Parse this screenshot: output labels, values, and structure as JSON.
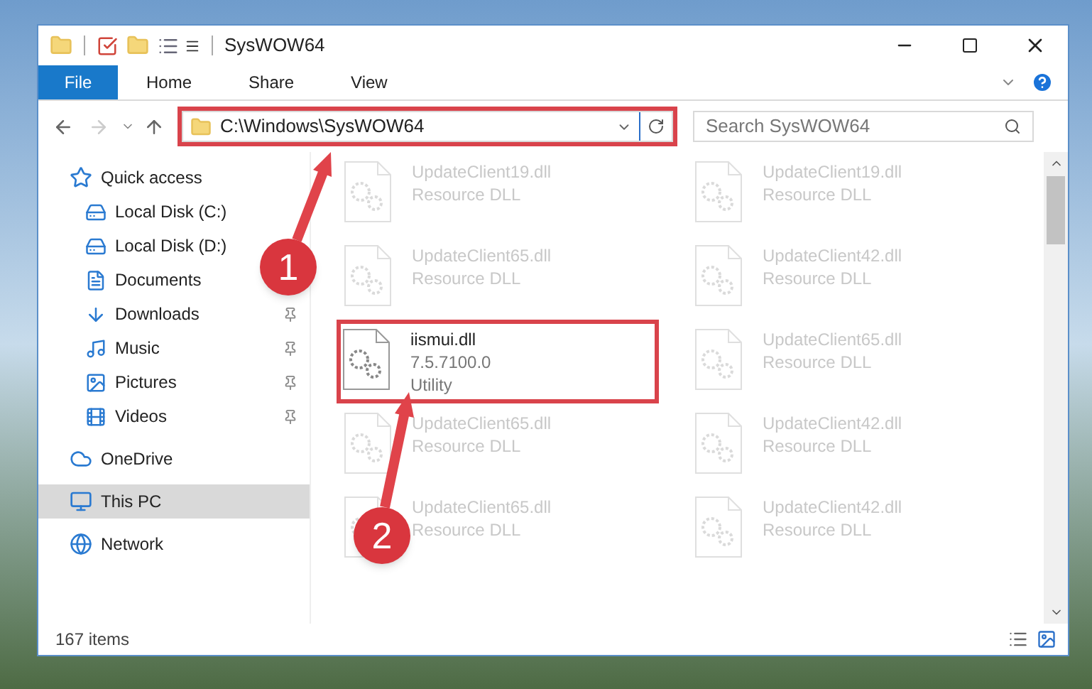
{
  "window": {
    "title": "SysWOW64"
  },
  "ribbon_tabs": [
    {
      "label": "File",
      "kind": "file"
    },
    {
      "label": "Home",
      "kind": "tab"
    },
    {
      "label": "Share",
      "kind": "tab"
    },
    {
      "label": "View",
      "kind": "tab"
    }
  ],
  "address_bar": {
    "path": "C:\\Windows\\SysWOW64",
    "highlighted": true
  },
  "search": {
    "placeholder": "Search SysWOW64"
  },
  "navigation": [
    {
      "label": "Quick access",
      "selected": false,
      "children": [
        {
          "label": "Local Disk (C:)",
          "pinned": false,
          "selected": false
        },
        {
          "label": "Local Disk (D:)",
          "pinned": false,
          "selected": false
        },
        {
          "label": "Documents",
          "pinned": false,
          "selected": false
        },
        {
          "label": "Downloads",
          "pinned": true,
          "selected": false
        },
        {
          "label": "Music",
          "pinned": true,
          "selected": false
        },
        {
          "label": "Pictures",
          "pinned": true,
          "selected": false
        },
        {
          "label": "Videos",
          "pinned": true,
          "selected": false
        }
      ]
    },
    {
      "label": "OneDrive",
      "selected": false
    },
    {
      "label": "This PC",
      "selected": true
    },
    {
      "label": "Network",
      "selected": false
    }
  ],
  "files": [
    {
      "name": "UpdateClient19.dll",
      "type": "Resource DLL",
      "faded": true,
      "highlighted": false
    },
    {
      "name": "UpdateClient19.dll",
      "type": "Resource DLL",
      "faded": true,
      "highlighted": false
    },
    {
      "name": "UpdateClient65.dll",
      "type": "Resource DLL",
      "faded": true,
      "highlighted": false
    },
    {
      "name": "UpdateClient42.dll",
      "type": "Resource DLL",
      "faded": true,
      "highlighted": false
    },
    {
      "name": "iismui.dll",
      "version": "7.5.7100.0",
      "type": "Utility",
      "faded": false,
      "highlighted": true
    },
    {
      "name": "UpdateClient65.dll",
      "type": "Resource DLL",
      "faded": true,
      "highlighted": false
    },
    {
      "name": "UpdateClient65.dll",
      "type": "Resource DLL",
      "faded": true,
      "highlighted": false
    },
    {
      "name": "UpdateClient42.dll",
      "type": "Resource DLL",
      "faded": true,
      "highlighted": false
    },
    {
      "name": "UpdateClient65.dll",
      "type": "Resource DLL",
      "faded": true,
      "highlighted": false
    },
    {
      "name": "UpdateClient42.dll",
      "type": "Resource DLL",
      "faded": true,
      "highlighted": false
    }
  ],
  "status_bar": {
    "item_count": "167 items"
  },
  "annotations": [
    {
      "number": "1"
    },
    {
      "number": "2"
    }
  ]
}
